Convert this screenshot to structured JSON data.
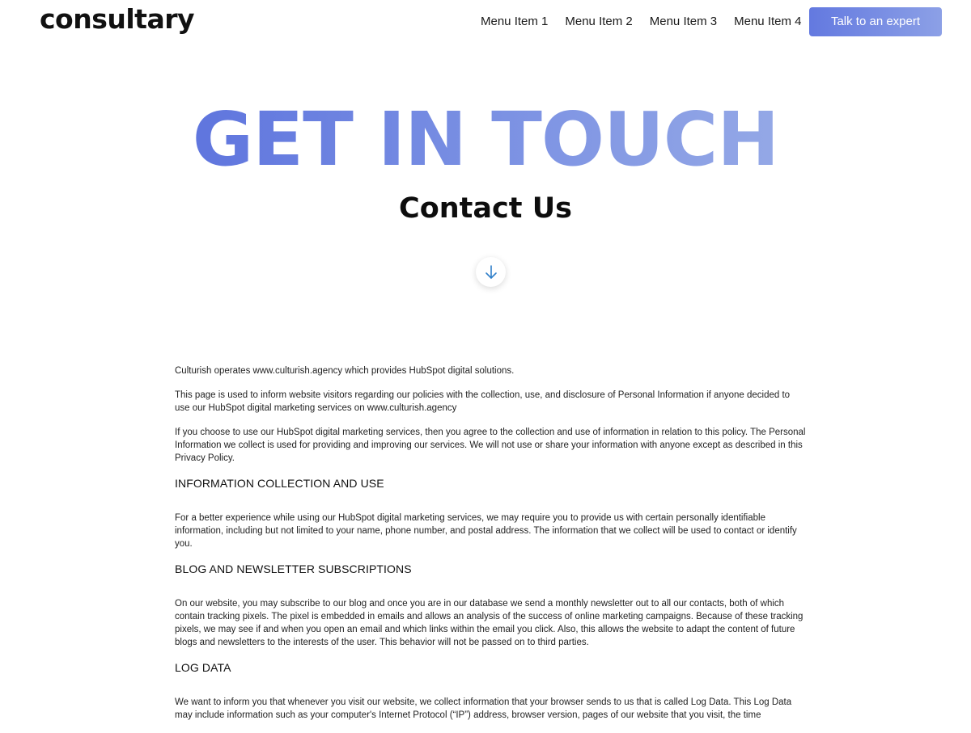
{
  "header": {
    "logo": "consultary",
    "nav": [
      "Menu Item 1",
      "Menu Item 2",
      "Menu Item 3",
      "Menu Item 4"
    ],
    "cta_label": "Talk to an expert"
  },
  "hero": {
    "title": "GET IN TOUCH",
    "subtitle": "Contact Us",
    "scroll_icon": "arrow-down-icon"
  },
  "content": {
    "intro": [
      "Culturish operates www.culturish.agency which provides HubSpot digital solutions.",
      "This page is used to inform website visitors regarding our policies with the collection, use, and disclosure of Personal Information if anyone decided to use our HubSpot digital marketing services on www.culturish.agency",
      "If you choose to use our HubSpot digital marketing services, then you agree to the collection and use of information in relation to this policy. The Personal Information we collect is used for providing and improving our services. We will not use or share your information with anyone except as described in this Privacy Policy."
    ],
    "sections": [
      {
        "heading": "INFORMATION COLLECTION AND USE",
        "body": "For a better experience while using our HubSpot digital marketing services, we may require you to provide us with certain personally identifiable information, including but not limited to your name, phone number, and postal address. The information that we collect will be used to contact or identify you."
      },
      {
        "heading": "BLOG AND NEWSLETTER SUBSCRIPTIONS",
        "body": "On our website, you may subscribe to our blog and once you are in our database we send a monthly newsletter out to all our contacts, both of which contain tracking pixels. The pixel is embedded in emails and allows an analysis of the success of online marketing campaigns. Because of these tracking pixels, we may see if and when you open an email and which links within the email you click. Also, this allows the website to adapt the content of future blogs and newsletters to the interests of the user. This behavior will not be passed on to third parties."
      },
      {
        "heading": "LOG DATA",
        "body": "We want to inform you that whenever you visit our website, we collect information that your browser sends to us that is called Log Data. This Log Data may include information such as your computer's Internet Protocol (“IP”) address, browser version, pages of our website that you visit, the time"
      }
    ]
  },
  "colors": {
    "accent_start": "#5f75de",
    "accent_end": "#94a8e6",
    "scroll_arrow": "#2f7fc9"
  }
}
